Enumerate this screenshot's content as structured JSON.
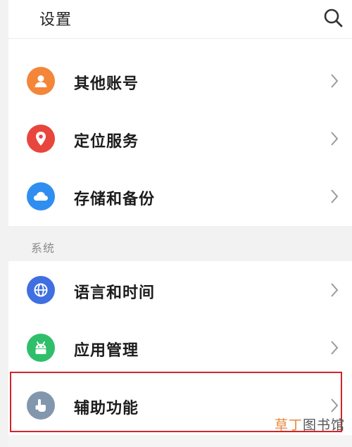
{
  "header": {
    "title": "设置",
    "search_icon": "search-icon"
  },
  "accounts": [
    {
      "label": "其他账号",
      "icon": "person-icon",
      "color": "#f4863a"
    },
    {
      "label": "定位服务",
      "icon": "location-pin-icon",
      "color": "#e8453c"
    },
    {
      "label": "存储和备份",
      "icon": "cloud-icon",
      "color": "#2f8ef0"
    }
  ],
  "system": {
    "section_label": "系统",
    "items": [
      {
        "label": "语言和时间",
        "icon": "globe-icon",
        "color": "#3f6fe0"
      },
      {
        "label": "应用管理",
        "icon": "android-icon",
        "color": "#2fbf6a"
      },
      {
        "label": "辅助功能",
        "icon": "hand-pointer-icon",
        "color": "#8296ad"
      }
    ]
  },
  "highlight_color": "#d0252a",
  "watermark": {
    "part1": "草丁",
    "part2": "图书馆"
  }
}
